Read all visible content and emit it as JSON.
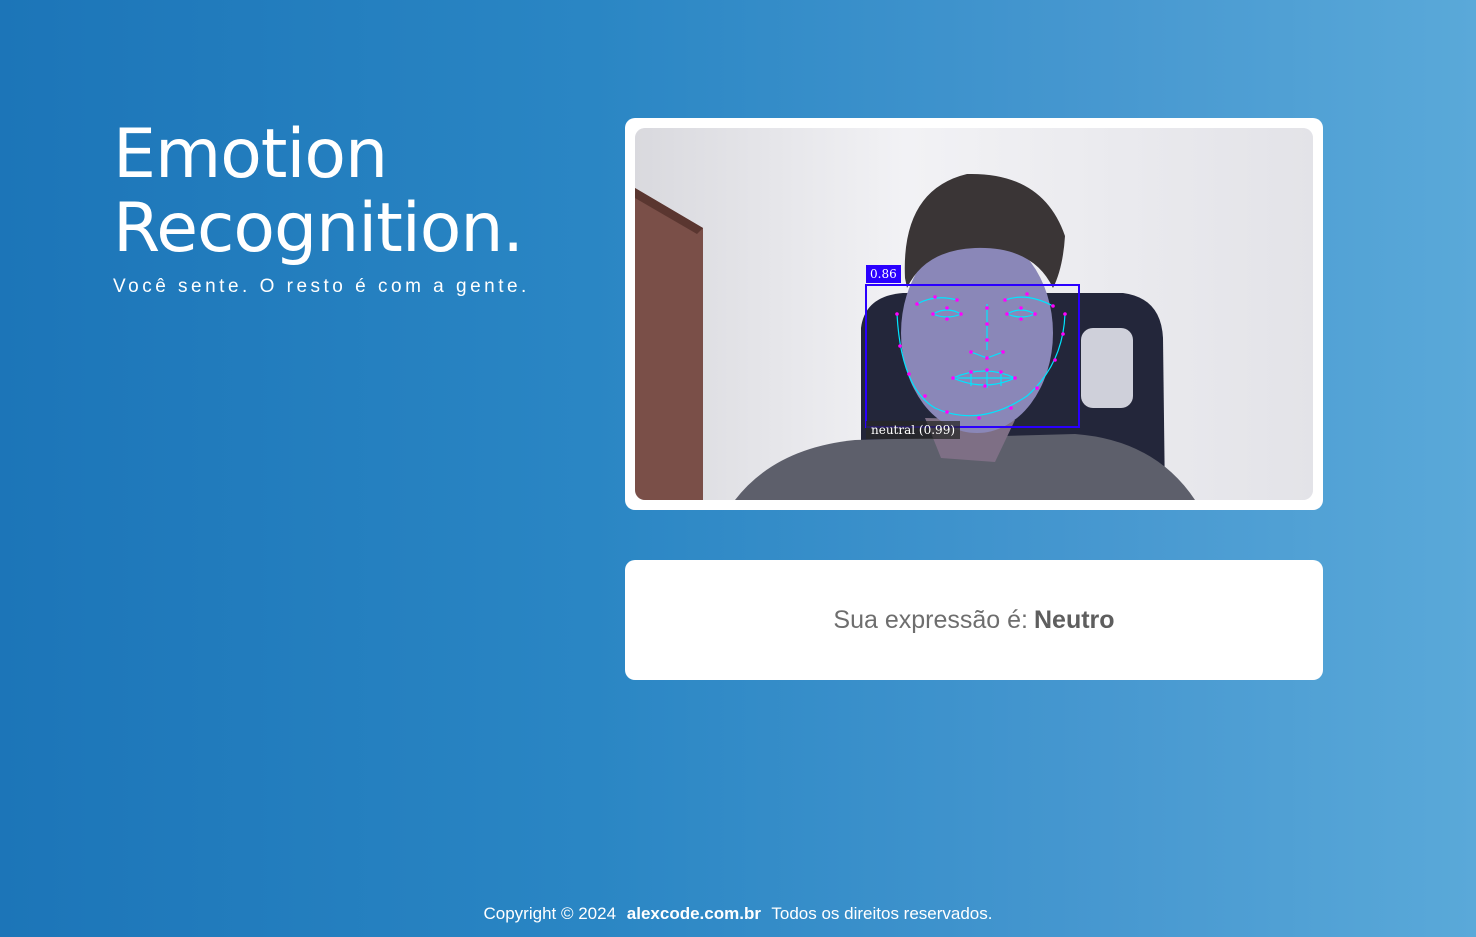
{
  "hero": {
    "title_line1": "Emotion",
    "title_line2": "Recognition.",
    "tagline": "Você sente. O resto é com a gente."
  },
  "video": {
    "detection_score": "0.86",
    "emotion_label": "neutral (0.99)",
    "box_color": "#2a00ff",
    "landmark_color": "#ff00ff",
    "contour_color": "#00e5ff"
  },
  "result": {
    "prefix": "Sua expressão é:",
    "value": "Neutro"
  },
  "footer": {
    "copyright": "Copyright © 2024",
    "brand": "alexcode.com.br",
    "rights": "Todos os direitos reservados."
  },
  "colors": {
    "background_start": "#1c75b8",
    "background_end": "#5aa9d9"
  }
}
